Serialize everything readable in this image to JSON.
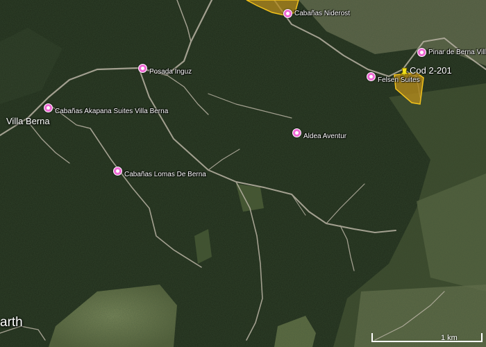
{
  "map": {
    "places": [
      {
        "label": "Villa Berna"
      }
    ],
    "partial_label": "arth",
    "pois": [
      {
        "label": "Cabañas Niderost"
      },
      {
        "label": "Pinar de Berna Villa"
      },
      {
        "label": "Felsen Suites"
      },
      {
        "label": "Posada Inguz"
      },
      {
        "label": "Cabañas Akapana Suites Villa Berna"
      },
      {
        "label": "Aldea Aventur"
      },
      {
        "label": "Cabañas Lomas De Berna"
      }
    ],
    "parcel": {
      "label": "Cod 2-201",
      "color": "#f2c21b"
    },
    "scale": {
      "label": "1 km"
    },
    "colors": {
      "poi": "#f06ad6",
      "parcel_fill": "#b38a1c",
      "parcel_edge": "#f2c21b",
      "road": "#b9b3a4"
    }
  }
}
